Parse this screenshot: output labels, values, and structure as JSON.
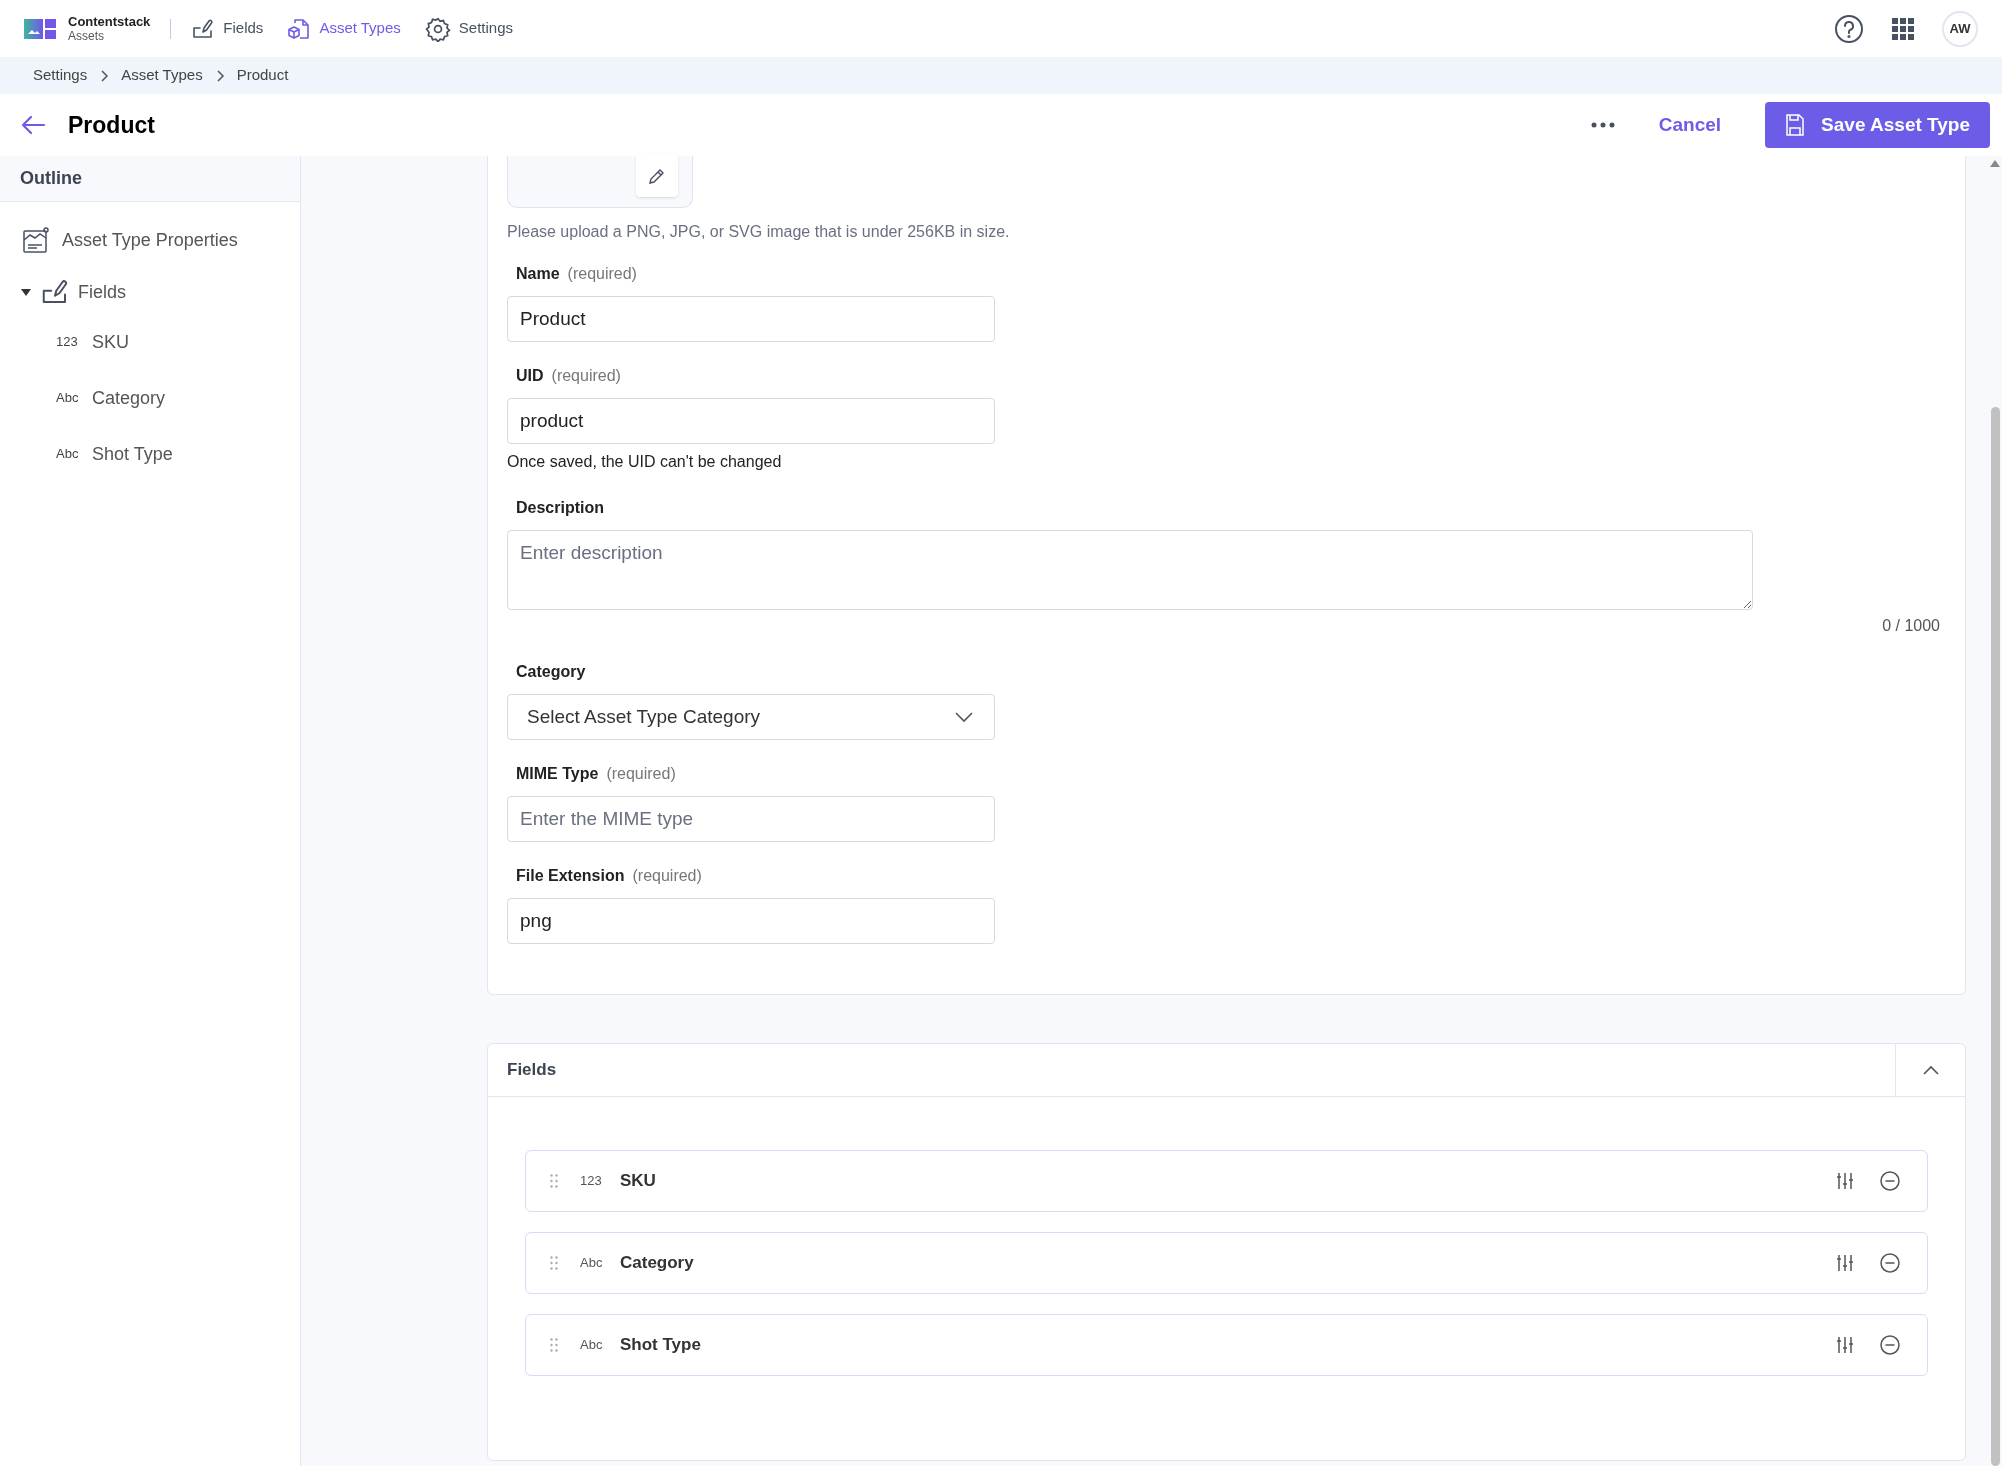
{
  "app": {
    "brand": "Contentstack",
    "product": "Assets"
  },
  "nav": [
    {
      "label": "Fields",
      "kind": "fields",
      "selected": false
    },
    {
      "label": "Asset Types",
      "kind": "asset-types",
      "selected": true
    },
    {
      "label": "Settings",
      "kind": "settings",
      "selected": false
    }
  ],
  "user": {
    "initials": "AW"
  },
  "breadcrumbs": [
    "Settings",
    "Asset Types",
    "Product"
  ],
  "page": {
    "title": "Product",
    "cancel": "Cancel",
    "save": "Save Asset Type"
  },
  "outline": {
    "title": "Outline",
    "items": [
      {
        "kind": "properties",
        "label": "Asset Type Properties"
      },
      {
        "kind": "group",
        "label": "Fields",
        "expanded": true,
        "children": [
          {
            "type_label": "123",
            "label": "SKU"
          },
          {
            "type_label": "Abc",
            "label": "Category"
          },
          {
            "type_label": "Abc",
            "label": "Shot Type"
          }
        ]
      }
    ]
  },
  "form": {
    "upload_hint": "Please upload a PNG, JPG, or SVG image that is under 256KB in size.",
    "fields": [
      {
        "kind": "input",
        "label": "Name",
        "qualifier": "(required)",
        "value": "Product"
      },
      {
        "kind": "input",
        "label": "UID",
        "qualifier": "(required)",
        "value": "product",
        "note": "Once saved, the UID can't be changed"
      },
      {
        "kind": "textarea",
        "label": "Description",
        "placeholder": "Enter description",
        "counter": "0 / 1000"
      },
      {
        "kind": "select",
        "label": "Category",
        "placeholder": "Select Asset Type Category"
      },
      {
        "kind": "input",
        "label": "MIME Type",
        "qualifier": "(required)",
        "placeholder": "Enter the MIME type"
      },
      {
        "kind": "input",
        "label": "File Extension",
        "qualifier": "(required)",
        "value": "png"
      }
    ]
  },
  "fields_panel": {
    "title": "Fields",
    "expanded": true,
    "rows": [
      {
        "type_label": "123",
        "label": "SKU"
      },
      {
        "type_label": "Abc",
        "label": "Category"
      },
      {
        "type_label": "Abc",
        "label": "Shot Type"
      }
    ]
  }
}
